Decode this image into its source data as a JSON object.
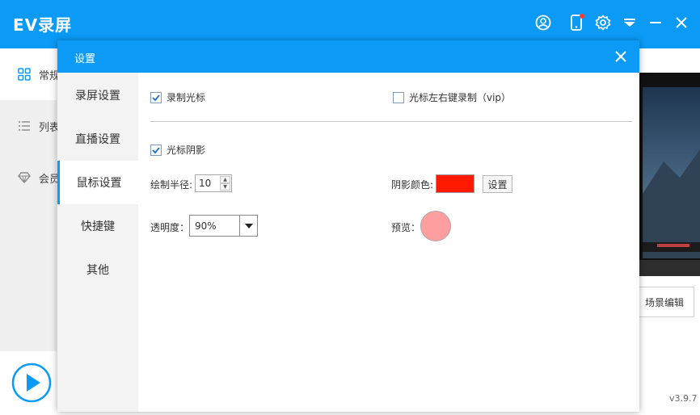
{
  "app": {
    "title": "EV录屏",
    "version": "v3.9.7",
    "accent_color": "#0b9bf7",
    "titlebar_icons": [
      "user-icon",
      "phone-icon",
      "gear-icon",
      "dropdown-menu-icon",
      "minimize-icon",
      "close-icon"
    ]
  },
  "main_nav": {
    "items": [
      {
        "label": "常规",
        "icon": "grid-icon"
      },
      {
        "label": "列表",
        "icon": "list-icon"
      },
      {
        "label": "会员",
        "icon": "diamond-icon"
      }
    ]
  },
  "main": {
    "scene_edit_label": "场景编辑"
  },
  "dialog": {
    "title": "设置",
    "tabs": [
      {
        "label": "录屏设置"
      },
      {
        "label": "直播设置"
      },
      {
        "label": "鼠标设置"
      },
      {
        "label": "快捷键"
      },
      {
        "label": "其他"
      }
    ],
    "active_tab": "鼠标设置",
    "record_cursor": {
      "label": "录制光标",
      "checked": true
    },
    "left_right_click": {
      "label": "光标左右键录制（vip）",
      "checked": false
    },
    "cursor_shadow": {
      "label": "光标阴影",
      "checked": true
    },
    "radius": {
      "label": "绘制半径:",
      "value": "10"
    },
    "shadow_color": {
      "label": "阴影颜色:",
      "color": "#ff1a00",
      "button_label": "设置"
    },
    "opacity": {
      "label": "透明度：",
      "value": "90%"
    },
    "preview": {
      "label": "预览：",
      "color": "#ff9e9e"
    }
  }
}
